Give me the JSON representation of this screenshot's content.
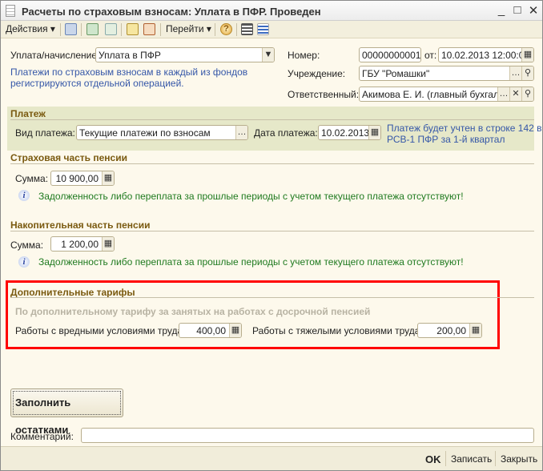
{
  "window": {
    "title": "Расчеты по страховым взносам: Уплата в ПФР. Проведен"
  },
  "toolbar": {
    "actions": "Действия ▾",
    "goto": "Перейти ▾"
  },
  "form": {
    "payment_type_label": "Уплата/начисление:",
    "payment_type_value": "Уплата в ПФР",
    "note": [
      "Платежи по страховым взносам в каждый из фондов",
      "регистрируются отдельной операцией."
    ],
    "number_label": "Номер:",
    "number_value": "00000000001",
    "date_label": "от:",
    "date_value": "10.02.2013 12:00:00",
    "org_label": "Учреждение:",
    "org_value": "ГБУ \"Ромашки\"",
    "resp_label": "Ответственный:",
    "resp_value": "Акимова Е. И. (главный бухгалтер)"
  },
  "payment": {
    "title": "Платеж",
    "kind_label": "Вид платежа:",
    "kind_value": "Текущие платежи по взносам",
    "date_label": "Дата платежа:",
    "date_value": "10.02.2013",
    "hint": [
      "Платеж будет учтен в строке 142 в",
      "РСВ-1 ПФР за 1-й квартал"
    ]
  },
  "insurance": {
    "title": "Страховая часть пенсии",
    "sum_label": "Сумма:",
    "sum_value": "10 900,00",
    "info": "Задолженность либо переплата за прошлые периоды с учетом текущего платежа отсутствуют!"
  },
  "funded": {
    "title": "Накопительная часть пенсии",
    "sum_label": "Сумма:",
    "sum_value": "1 200,00",
    "info": "Задолженность либо переплата за прошлые периоды с учетом текущего платежа отсутствуют!"
  },
  "extra": {
    "title": "Дополнительные тарифы",
    "subtitle": "По дополнительному тарифу за занятых на работах с досрочной пенсией",
    "harmful_label": "Работы с вредными условиями труда:",
    "harmful_value": "400,00",
    "hard_label": "Работы с тяжелыми условиями труда:",
    "hard_value": "200,00"
  },
  "fill_button": "Заполнить остатками",
  "comment": {
    "label": "Комментарий:",
    "value": ""
  },
  "footer": {
    "ok": "OK",
    "save": "Записать",
    "close": "Закрыть"
  }
}
